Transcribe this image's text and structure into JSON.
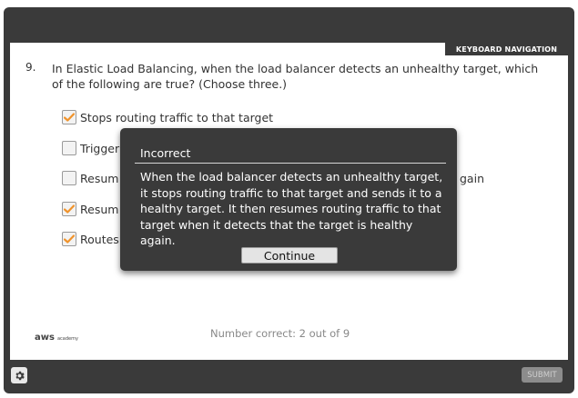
{
  "slide": {
    "keyboard_nav_label": "KEYBOARD NAVIGATION",
    "question_number": "9.",
    "question_text": "In Elastic Load Balancing, when the load balancer detects an unhealthy target, which of the following are true? (Choose three.)",
    "options": [
      {
        "label": "Stops routing traffic to that target",
        "checked": true
      },
      {
        "label": "Trigger",
        "checked": false
      },
      {
        "label": "Resum",
        "trailing_label": "gain",
        "checked": false
      },
      {
        "label": "Resum",
        "checked": true
      },
      {
        "label": "Routes",
        "checked": true
      }
    ],
    "score_text": "Number correct: 2 out of 9",
    "logo": {
      "brand": "aws",
      "sub": "academy"
    }
  },
  "footer": {
    "settings_icon": "gear-icon",
    "submit_label": "SUBMIT"
  },
  "feedback": {
    "title": "Incorrect",
    "message": "When the load balancer detects an unhealthy target, it stops routing traffic to that target and sends it to a healthy target. It then resumes routing traffic to that target when it detects that the target is healthy again.",
    "continue_label": "Continue"
  },
  "colors": {
    "chrome": "#3a3a3a",
    "check": "#f0932b",
    "muted_text": "#888888"
  }
}
